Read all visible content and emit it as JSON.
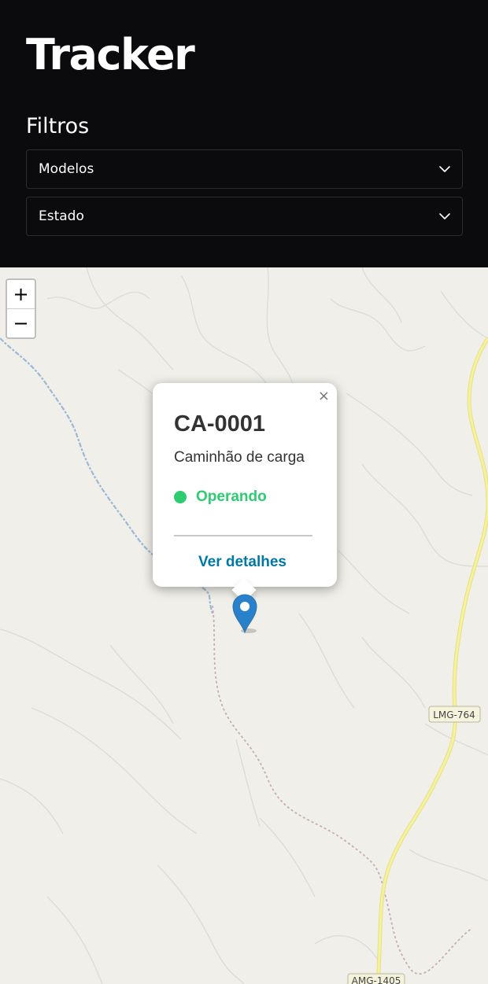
{
  "app": {
    "title": "Tracker"
  },
  "filters": {
    "title": "Filtros",
    "models": {
      "value": "Modelos"
    },
    "state": {
      "value": "Estado"
    }
  },
  "map": {
    "zoom_in": "+",
    "zoom_out": "−",
    "road_labels": [
      "LMG-764",
      "AMG-1405"
    ],
    "popup": {
      "close": "×",
      "vehicle_id": "CA-0001",
      "vehicle_type": "Caminhão de carga",
      "status": "Operando",
      "details_link": "Ver detalhes"
    }
  },
  "colors": {
    "header_bg": "#0b0b0d",
    "map_bg": "#f1efe9",
    "status_operating": "#2ecc71",
    "link": "#0078a8",
    "marker": "#2a81cb",
    "road_major": "#f5f29a",
    "river": "#9ab9d6"
  },
  "icons": [
    "chevron-down-icon",
    "close-icon",
    "map-marker-icon"
  ]
}
